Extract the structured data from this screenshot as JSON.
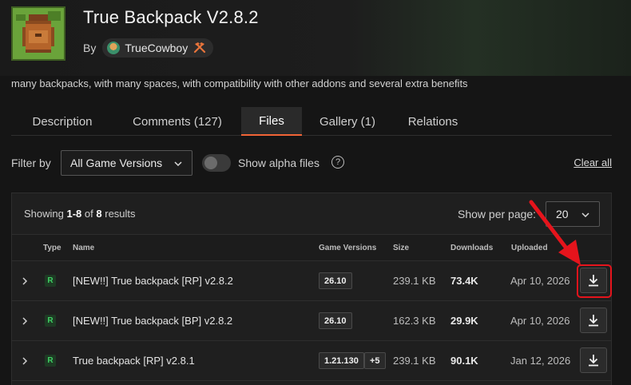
{
  "project": {
    "title": "True Backpack V2.8.2",
    "by_label": "By",
    "author": "TrueCowboy",
    "summary": "many backpacks, with many spaces, with compatibility with other addons and several extra benefits"
  },
  "tabs": [
    {
      "label": "Description",
      "active": false
    },
    {
      "label": "Comments (127)",
      "active": false
    },
    {
      "label": "Files",
      "active": true
    },
    {
      "label": "Gallery (1)",
      "active": false
    },
    {
      "label": "Relations",
      "active": false
    }
  ],
  "filters": {
    "filter_label": "Filter by",
    "game_version_selected": "All Game Versions",
    "alpha_toggle_label": "Show alpha files",
    "alpha_toggle_on": false,
    "help_symbol": "?",
    "clear_all": "Clear all"
  },
  "results": {
    "showing_prefix": "Showing",
    "range": "1-8",
    "of": "of",
    "total": "8",
    "suffix": "results",
    "per_page_label": "Show per page:",
    "per_page_value": "20"
  },
  "table": {
    "headers": [
      "Type",
      "Name",
      "Game Versions",
      "Size",
      "Downloads",
      "Uploaded"
    ],
    "rows": [
      {
        "type": "R",
        "name": "[NEW!!] True backpack [RP] v2.8.2",
        "versions": [
          "26.10"
        ],
        "size": "239.1 KB",
        "downloads": "73.4K",
        "uploaded": "Apr 10, 2026"
      },
      {
        "type": "R",
        "name": "[NEW!!] True backpack [BP] v2.8.2",
        "versions": [
          "26.10"
        ],
        "size": "162.3 KB",
        "downloads": "29.9K",
        "uploaded": "Apr 10, 2026"
      },
      {
        "type": "R",
        "name": "True backpack [RP] v2.8.1",
        "versions": [
          "1.21.130",
          "+5"
        ],
        "size": "239.1 KB",
        "downloads": "90.1K",
        "uploaded": "Jan 12, 2026"
      }
    ]
  },
  "colors": {
    "accent": "#f16436",
    "release_badge": "#3fcf63",
    "annotation": "#e5141c"
  },
  "icons": [
    "backpack-thumbnail",
    "author-avatar",
    "hammer-pickaxe-icon",
    "chevron-down-icon",
    "help-icon",
    "chevron-right-icon",
    "download-icon",
    "annotation-arrow"
  ]
}
